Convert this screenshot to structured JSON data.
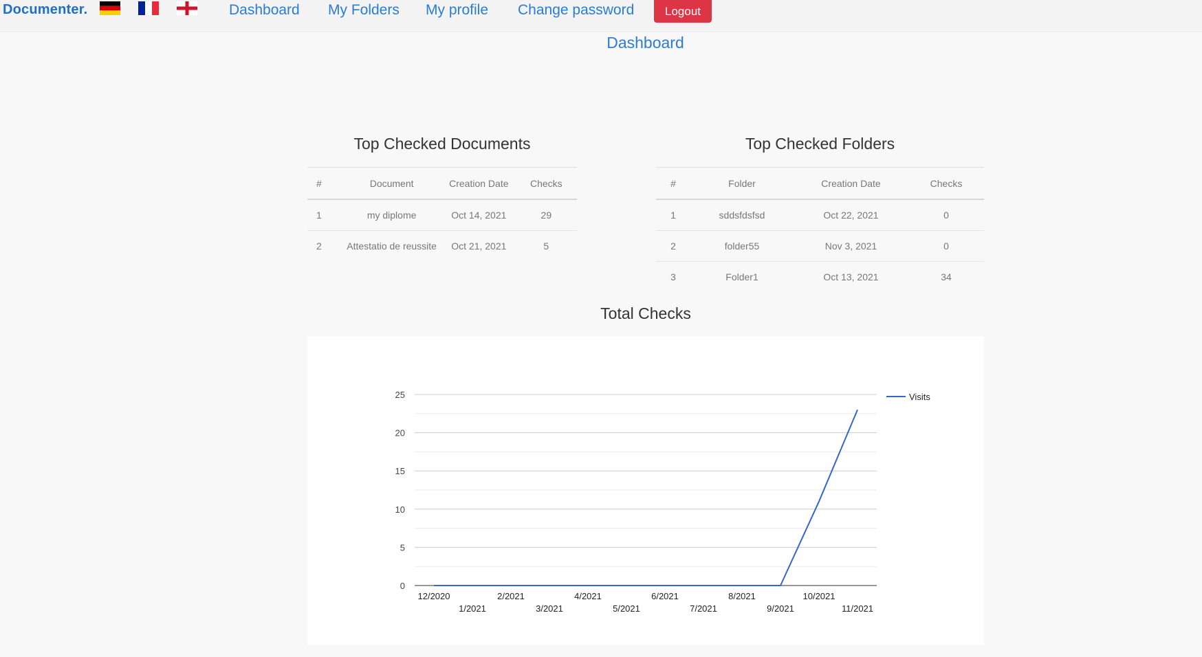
{
  "brand": "Documenter.",
  "flags": [
    "german-flag-icon",
    "french-flag-icon",
    "english-flag-icon"
  ],
  "nav": {
    "dashboard": "Dashboard",
    "my_folders": "My Folders",
    "my_profile": "My profile",
    "change_password": "Change password",
    "logout": "Logout"
  },
  "page_title": "Dashboard",
  "documents": {
    "title": "Top Checked Documents",
    "columns": [
      "#",
      "Document",
      "Creation Date",
      "Checks"
    ],
    "rows": [
      [
        "1",
        "my diplome",
        "Oct 14, 2021",
        "29"
      ],
      [
        "2",
        "Attestatio de reussite",
        "Oct 21, 2021",
        "5"
      ]
    ]
  },
  "folders": {
    "title": "Top Checked Folders",
    "columns": [
      "#",
      "Folder",
      "Creation Date",
      "Checks"
    ],
    "rows": [
      [
        "1",
        "sddsfdsfsd",
        "Oct 22, 2021",
        "0"
      ],
      [
        "2",
        "folder55",
        "Nov 3, 2021",
        "0"
      ],
      [
        "3",
        "Folder1",
        "Oct 13, 2021",
        "34"
      ]
    ]
  },
  "chart_section_title": "Total Checks",
  "colors": {
    "brand": "#1f6fc5",
    "link": "#2a7dd1",
    "logout": "#dc3545",
    "series": "#3366cc"
  },
  "chart_data": {
    "type": "line",
    "title": "",
    "xlabel": "",
    "ylabel": "",
    "x": [
      "12/2020",
      "1/2021",
      "2/2021",
      "3/2021",
      "4/2021",
      "5/2021",
      "6/2021",
      "7/2021",
      "8/2021",
      "9/2021",
      "10/2021",
      "11/2021"
    ],
    "series": [
      {
        "name": "Visits",
        "values": [
          0,
          0,
          0,
          0,
          0,
          0,
          0,
          0,
          0,
          0,
          11,
          23
        ]
      }
    ],
    "ylim": [
      0,
      25
    ],
    "yticks": [
      "0",
      "5",
      "10",
      "15",
      "20",
      "25"
    ],
    "grid": true,
    "legend": "right"
  }
}
